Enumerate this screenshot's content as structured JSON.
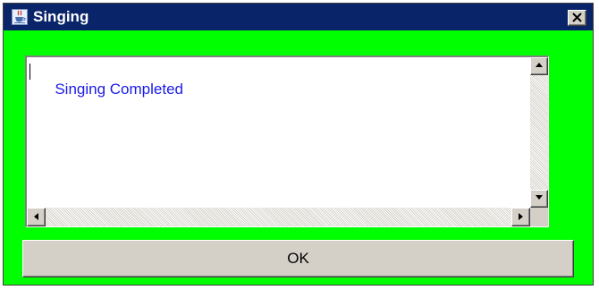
{
  "window": {
    "title": "Singing",
    "app_icon": "java-cup-icon",
    "close_icon": "close-icon",
    "background_color": "#00ff00",
    "titlebar_color": "#0a246a"
  },
  "message": {
    "text": "Singing Completed",
    "text_color": "#1a1ae6"
  },
  "scrollbars": {
    "up_icon": "arrow-up-icon",
    "down_icon": "arrow-down-icon",
    "left_icon": "arrow-left-icon",
    "right_icon": "arrow-right-icon"
  },
  "buttons": {
    "ok_label": "OK"
  }
}
